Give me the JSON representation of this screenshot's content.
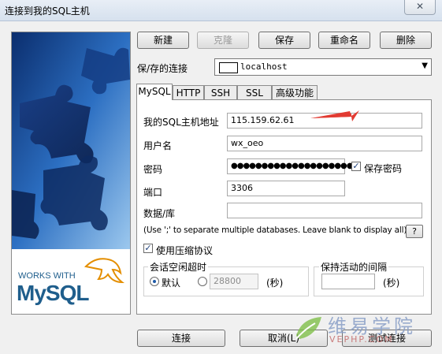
{
  "window": {
    "title": "连接到我的SQL主机",
    "close_glyph": "✕"
  },
  "toolbar": {
    "new_label": "新建",
    "clone_label": "克隆",
    "save_label": "保存",
    "rename_label": "重命名",
    "delete_label": "删除"
  },
  "connection": {
    "label": "保/存的连接",
    "value": "localhost"
  },
  "tabs": [
    {
      "label": "MySQL",
      "active": true
    },
    {
      "label": "HTTP",
      "active": false
    },
    {
      "label": "SSH",
      "active": false
    },
    {
      "label": "SSL",
      "active": false
    },
    {
      "label": "高级功能",
      "active": false
    }
  ],
  "mysql": {
    "host_label": "我的SQL主机地址",
    "host_value": "115.159.62.61",
    "user_label": "用户名",
    "user_value": "wx_oeo",
    "password_label": "密码",
    "password_value": "●●●●●●●●●●●●●●●●●●●●●",
    "save_password_label": "保存密码",
    "save_password_checked": true,
    "port_label": "端口",
    "port_value": "3306",
    "database_label": "数据/库",
    "database_value": "",
    "hint": "(Use ';' to separate multiple databases. Leave blank to display all)",
    "hint_button": "?",
    "compress_label": "使用压缩协议",
    "compress_checked": true,
    "session_timeout": {
      "title": "会话空闲超时",
      "default_label": "默认",
      "custom_value": "28800",
      "unit": "(秒)",
      "selected": "default"
    },
    "keepalive": {
      "title": "保持活动的间隔",
      "value": "",
      "unit": "(秒)"
    }
  },
  "footer": {
    "connect_label": "连接",
    "cancel_label": "取消(L)",
    "test_label": "测试连接"
  },
  "logo": {
    "works_with": "WORKS WITH",
    "brand": "MySQL"
  },
  "watermark": {
    "cn": "维易学院",
    "en": "VEPHP.COM"
  },
  "colors": {
    "arrow": "#e23b32",
    "logo_blue": "#1f5e8c",
    "logo_orange": "#e48e00",
    "watermark": "#8aa0c8"
  }
}
